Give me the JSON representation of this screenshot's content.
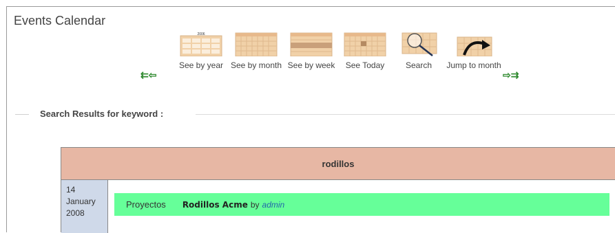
{
  "header": {
    "title": "Events Calendar"
  },
  "nav": {
    "prev_glyph": "⇇⇦",
    "next_glyph": "⇨⇉",
    "year_badge": "2006",
    "items": [
      {
        "label": "See by year",
        "icon": "calendar-year-icon"
      },
      {
        "label": "See by month",
        "icon": "calendar-month-icon"
      },
      {
        "label": "See by week",
        "icon": "calendar-week-icon"
      },
      {
        "label": "See Today",
        "icon": "calendar-today-icon"
      },
      {
        "label": "Search",
        "icon": "magnifier-icon"
      },
      {
        "label": "Jump to month",
        "icon": "jump-arrow-icon"
      }
    ]
  },
  "search": {
    "label": "Search Results for keyword :"
  },
  "results": {
    "keyword": "rodillos",
    "rows": [
      {
        "day": "14",
        "month": "January",
        "year": "2008",
        "category": "Proyectos",
        "title": "Rodillos Acme",
        "by": "by",
        "author": "admin"
      }
    ]
  },
  "colors": {
    "header_bg": "#e7b7a4",
    "date_bg": "#cfd9e9",
    "event_bg": "#66ff99",
    "calendar_icon": "#f1d1a8",
    "arrow": "#2f8a2f",
    "author": "#2266aa"
  }
}
